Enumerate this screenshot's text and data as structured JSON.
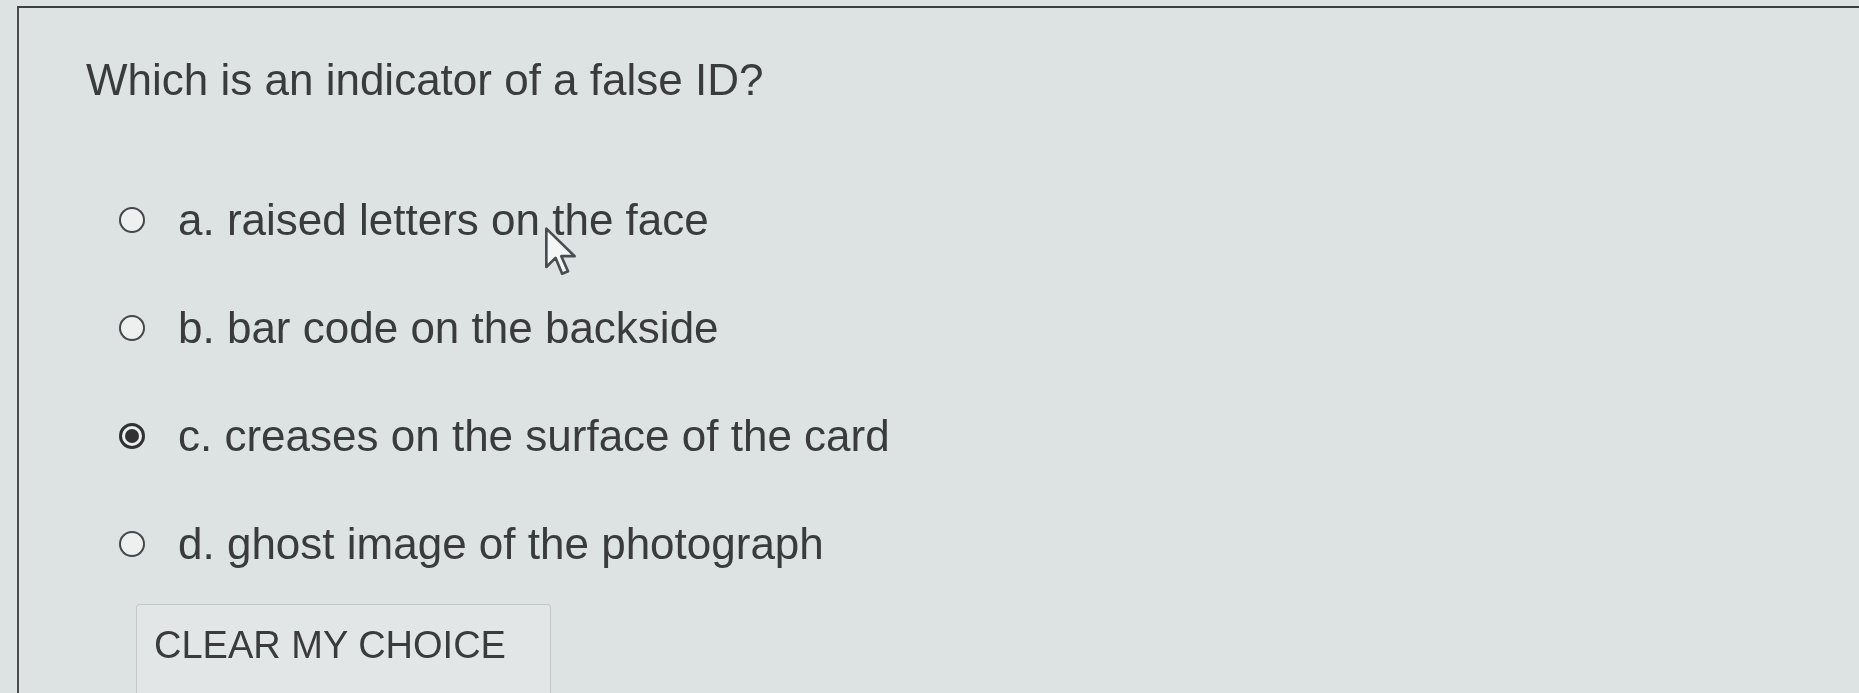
{
  "question": {
    "text": "Which is an indicator of a false ID?"
  },
  "options": [
    {
      "label": "a. raised letters on the face",
      "selected": false
    },
    {
      "label": "b. bar code on the backside",
      "selected": false
    },
    {
      "label": "c. creases on the surface of the card",
      "selected": true
    },
    {
      "label": "d. ghost image of the photograph",
      "selected": false
    }
  ],
  "clear_button": {
    "label": "CLEAR MY CHOICE"
  }
}
